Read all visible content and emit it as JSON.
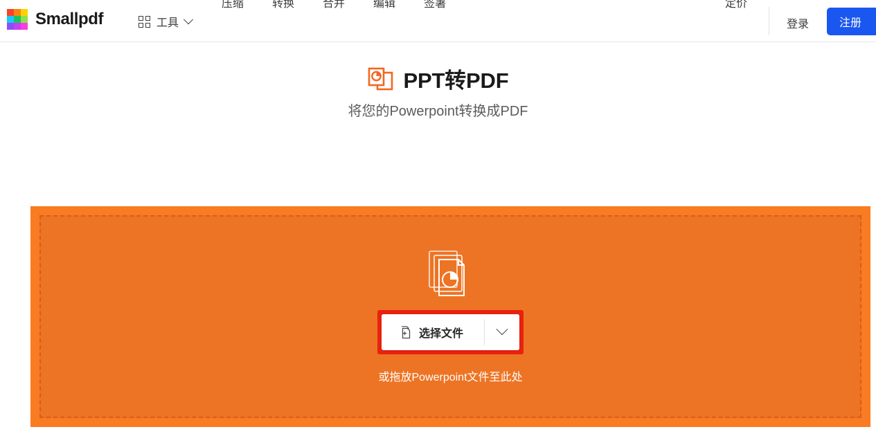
{
  "colors": {
    "brand_blue": "#1a56f0",
    "dropzone_outer_orange": "#f97b22",
    "dropzone_inner_orange": "#ed7424",
    "dropzone_dash_border": "#d35f18",
    "tool_icon_orange": "#f26722",
    "highlight_red": "#e8220f",
    "text_dark": "#1a1a1a",
    "text_muted": "#5b5b5f"
  },
  "header": {
    "brand_name": "Smallpdf",
    "logo_cells": [
      "#f8432a",
      "#f98410",
      "#fad400",
      "#1bc8f8",
      "#17c464",
      "#8ee24a",
      "#8b4ff6",
      "#c340f4",
      "#fa3ce0"
    ],
    "tools_label": "工具",
    "nav_items": [
      {
        "label": "压缩"
      },
      {
        "label": "转换"
      },
      {
        "label": "合并"
      },
      {
        "label": "编辑"
      },
      {
        "label": "签署"
      }
    ],
    "pricing_label": "定价",
    "login_label": "登录",
    "signup_label": "注册"
  },
  "main": {
    "title": "PPT转PDF",
    "subtitle": "将您的Powerpoint转换成PDF",
    "dropzone": {
      "choose_file_label": "选择文件",
      "drop_hint": "或拖放Powerpoint文件至此处"
    }
  }
}
